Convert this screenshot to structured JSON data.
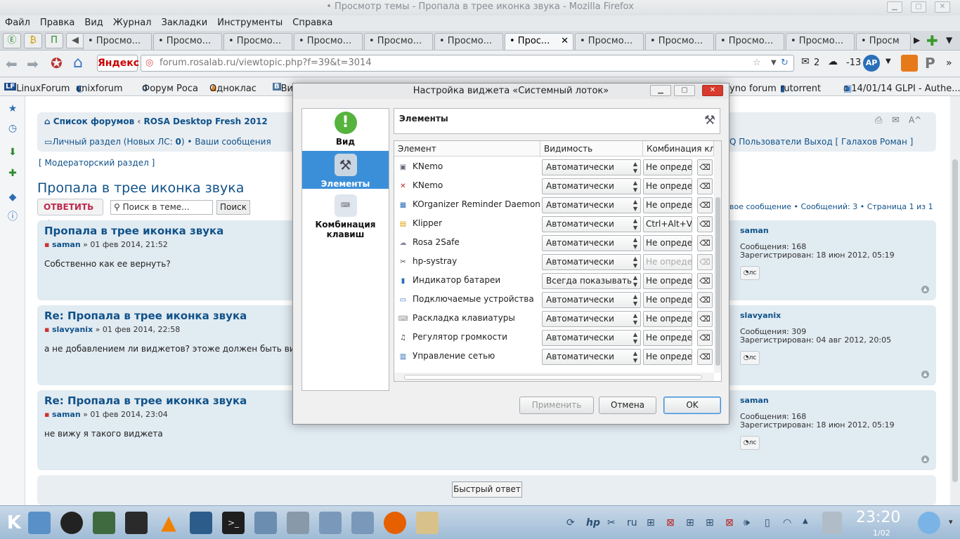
{
  "window": {
    "title": "• Просмотр темы - Пропала в трее иконка звука - Mozilla Firefox"
  },
  "menu": [
    "Файл",
    "Правка",
    "Вид",
    "Журнал",
    "Закладки",
    "Инструменты",
    "Справка"
  ],
  "tabs": [
    "• Просмо...",
    "• Просмо...",
    "• Просмо...",
    "• Просмо...",
    "• Просмо...",
    "• Просмо...",
    "• Прос...",
    "• Просмо...",
    "• Просмо...",
    "• Просмо...",
    "• Просмо...",
    "• Просм"
  ],
  "tab_close": "✕",
  "nav": {
    "search_engine": "Яндекс",
    "url": "forum.rosalab.ru/viewtopic.php?f=39&t=3014",
    "mail_count": "2",
    "weather": "-13"
  },
  "bookmarks": [
    "LinuxForum",
    "unixforum",
    "Форум Роса",
    "Одноклас",
    "Ви",
    "yno forum",
    "rutorrent",
    "с 14/01/14 GLPI - Authe..."
  ],
  "forum": {
    "breadcrumb": [
      "Список форумов",
      "ROSA Desktop Fresh 2012"
    ],
    "pm": "Личный раздел (Новых ЛС: ",
    "pm_count": "0",
    "pm_close": ")",
    "my_msgs": "Ваши сообщения",
    "users": "Пользователи",
    "logout": "Выход",
    "username": "Галахов Роман",
    "q": "Q",
    "moderator": "Модераторский раздел",
    "topic_title": "Пропала в трее иконка звука",
    "reply_btn": "ОТВЕТИТЬ",
    "search_placeholder": "Поиск в теме...",
    "search_btn": "Поиск",
    "pagination": "вое сообщение • Сообщений: 3 • Страница 1 из 1",
    "posts": [
      {
        "title": "Пропала в трее иконка звука",
        "author": "saman",
        "date": " » 01 фев 2014, 21:52",
        "body": "Собственно как ее вернуть?",
        "user": "saman",
        "msgs": "Сообщения: 168",
        "reg": "Зарегистрирован: 18 июн 2012, 05:19"
      },
      {
        "title": "Re: Пропала в трее иконка звука",
        "author": "slavyanix",
        "date": " » 01 фев 2014, 22:58",
        "body": "а не добавлением ли виджетов? этоже должен быть видж",
        "user": "slavyanix",
        "msgs": "Сообщения: 309",
        "reg": "Зарегистрирован: 04 авг 2012, 20:05"
      },
      {
        "title": "Re: Пропала в трее иконка звука",
        "author": "saman",
        "date": " » 01 фев 2014, 23:04",
        "body": "не вижу я такого виджета",
        "user": "saman",
        "msgs": "Сообщения: 168",
        "reg": "Зарегистрирован: 18 июн 2012, 05:19"
      }
    ],
    "ls_label": "лс",
    "quick_reply": "Быстрый ответ"
  },
  "dialog": {
    "title": "Настройка виджета «Системный лоток»",
    "nav": [
      "Вид",
      "Элементы",
      "Комбинация клавиш"
    ],
    "section_title": "Элементы",
    "columns": [
      "Элемент",
      "Видимость",
      "Комбинация кл"
    ],
    "rows": [
      {
        "name": "KNemo",
        "visibility": "Автоматически",
        "shortcut": "Не опреде.",
        "disabled": false
      },
      {
        "name": "KNemo",
        "visibility": "Автоматически",
        "shortcut": "Не опреде.",
        "disabled": false
      },
      {
        "name": "KOrganizer Reminder Daemon",
        "visibility": "Автоматически",
        "shortcut": "Не опреде.",
        "disabled": false
      },
      {
        "name": "Klipper",
        "visibility": "Автоматически",
        "shortcut": "Ctrl+Alt+V",
        "disabled": false
      },
      {
        "name": "Rosa 2Safe",
        "visibility": "Автоматически",
        "shortcut": "Не опреде.",
        "disabled": false
      },
      {
        "name": "hp-systray",
        "visibility": "Автоматически",
        "shortcut": "Не опреде.",
        "disabled": true
      },
      {
        "name": "Индикатор батареи",
        "visibility": "Всегда показывать",
        "shortcut": "Не опреде.",
        "disabled": false
      },
      {
        "name": "Подключаемые устройства",
        "visibility": "Автоматически",
        "shortcut": "Не опреде.",
        "disabled": false
      },
      {
        "name": "Раскладка клавиатуры",
        "visibility": "Автоматически",
        "shortcut": "Не опреде.",
        "disabled": false
      },
      {
        "name": "Регулятор громкости",
        "visibility": "Автоматически",
        "shortcut": "Не опреде.",
        "disabled": false
      },
      {
        "name": "Управление сетью",
        "visibility": "Автоматически",
        "shortcut": "Не опреде.",
        "disabled": false
      }
    ],
    "apply": "Применить",
    "cancel": "Отмена",
    "ok": "OK"
  },
  "taskbar": {
    "time": "23:20",
    "date": "1/02",
    "lang": "ru"
  }
}
